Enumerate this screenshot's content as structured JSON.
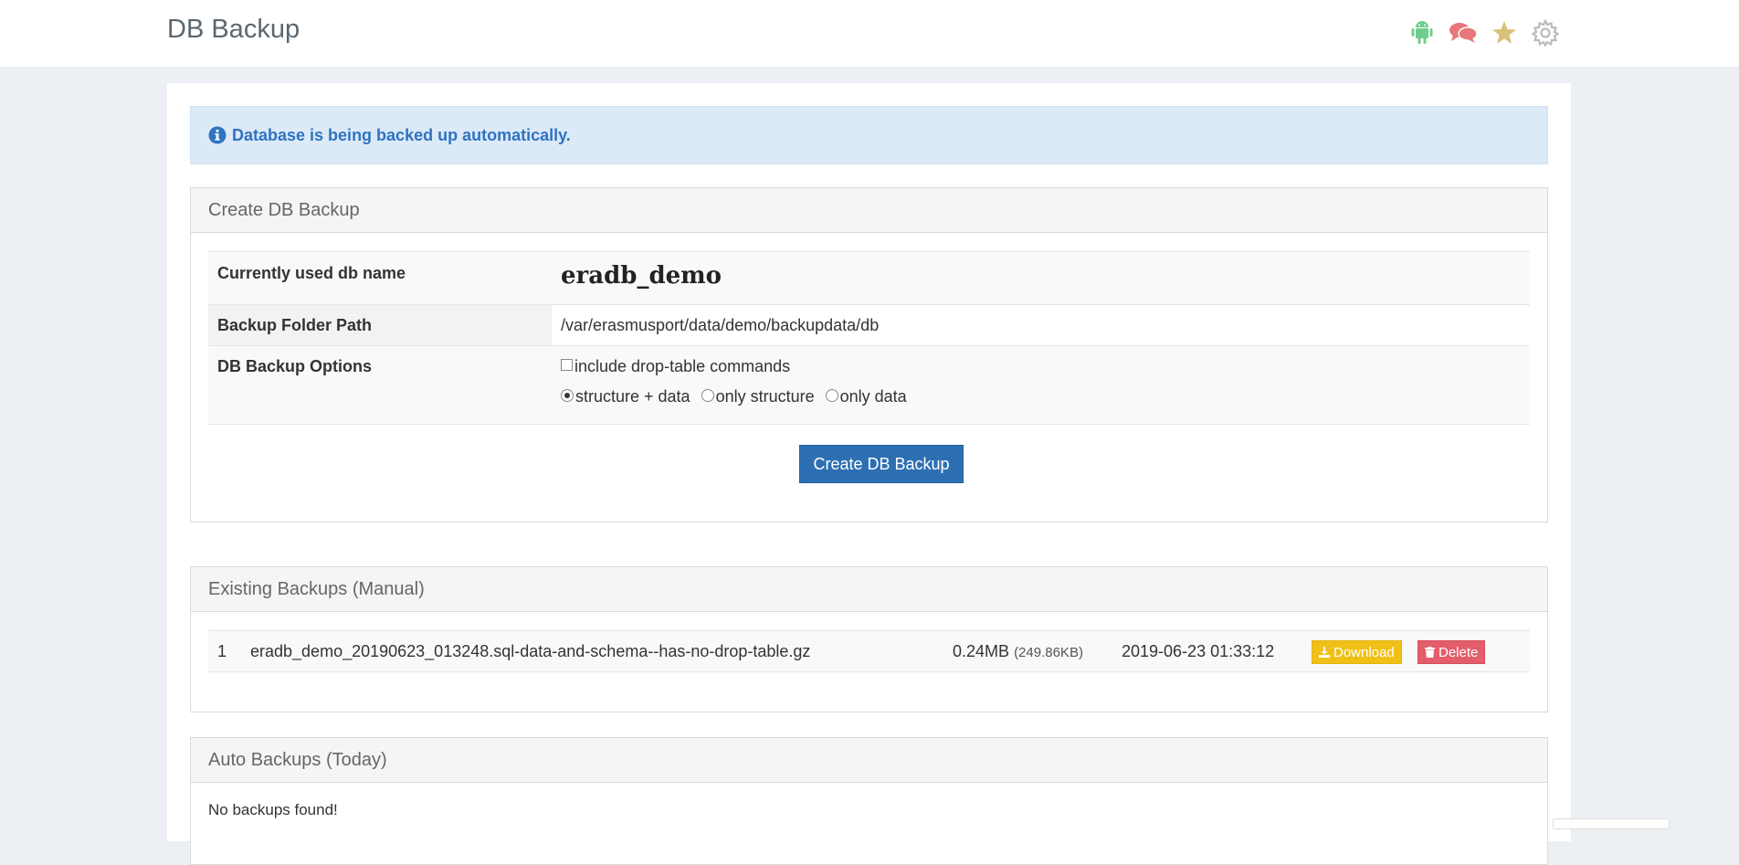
{
  "header": {
    "title": "DB Backup",
    "icons": [
      {
        "name": "android-icon",
        "color": "#6dcf8b"
      },
      {
        "name": "chat-icon",
        "color": "#e8767a"
      },
      {
        "name": "star-icon",
        "color": "#d8c27a"
      },
      {
        "name": "gear-icon",
        "color": "#bcbcbc"
      }
    ]
  },
  "alert": {
    "text": "Database is being backed up automatically.",
    "icon": "info-icon",
    "color": "#2f73c1"
  },
  "create_panel": {
    "title": "Create DB Backup",
    "rows": [
      {
        "label": "Currently used db name",
        "value": "eradb_demo"
      },
      {
        "label": "Backup Folder Path",
        "value": "/var/erasmusport/data/demo/backupdata/db"
      },
      {
        "label": "DB Backup Options"
      }
    ],
    "options": {
      "checkbox_label": "include drop-table commands",
      "checkbox_checked": false,
      "radios": [
        {
          "label": "structure + data",
          "checked": true
        },
        {
          "label": "only structure",
          "checked": false
        },
        {
          "label": "only data",
          "checked": false
        }
      ]
    },
    "button_label": "Create DB Backup"
  },
  "manual_panel": {
    "title": "Existing Backups (Manual)",
    "backups": [
      {
        "index": "1",
        "filename": "eradb_demo_20190623_013248.sql-data-and-schema--has-no-drop-table.gz",
        "size": "0.24MB",
        "size_detail": "(249.86KB)",
        "date": "2019-06-23 01:33:12",
        "download_label": "Download",
        "delete_label": "Delete"
      }
    ]
  },
  "auto_panel": {
    "title": "Auto Backups (Today)",
    "empty_text": "No backups found!"
  }
}
